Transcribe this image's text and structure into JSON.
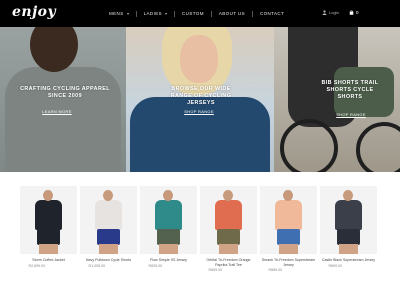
{
  "header": {
    "logo": "enjoy",
    "nav": [
      {
        "label": "MENS",
        "dropdown": true
      },
      {
        "label": "LADIES",
        "dropdown": true
      },
      {
        "label": "CUSTOM",
        "dropdown": false
      },
      {
        "label": "ABOUT US",
        "dropdown": false
      },
      {
        "label": "CONTACT",
        "dropdown": false
      }
    ],
    "account_label": "Login",
    "cart_count": "0"
  },
  "hero": {
    "panels": [
      {
        "title": "CRAFTING CYCLING APPAREL SINCE 2009",
        "link": "LEARN MORE"
      },
      {
        "title": "BROWSE OUR WIDE RANGE OF CYCLING JERSEYS",
        "link": "SHOP RANGE"
      },
      {
        "title": "BIB SHORTS TRAIL SHORTS CYCLE SHORTS",
        "link": "SHOP RANGE"
      }
    ]
  },
  "products": [
    {
      "name": "Storm Cuffed Jacket",
      "price": "R2,699.00",
      "top_color": "#1f232b",
      "bottom_color": "#1f232b"
    },
    {
      "name": "Navy Pulldown Cycle Shorts",
      "price": "R1,095.00",
      "top_color": "#e6e3e0",
      "bottom_color": "#2a3a8a"
    },
    {
      "name": "Flow Simple SS Jersey",
      "price": "R839.00",
      "top_color": "#2f8a8a",
      "bottom_color": "#53614f"
    },
    {
      "name": "Orbital Tri-Freedom Orange Paprika Trail Tee",
      "price": "R659.00",
      "top_color": "#e06d4f",
      "bottom_color": "#6f6a4a"
    },
    {
      "name": "Smash Tri-Freedom Superstream Jersey",
      "price": "R889.00",
      "top_color": "#f0b99a",
      "bottom_color": "#3f6fb0"
    },
    {
      "name": "Castle Black Superstream Jersey",
      "price": "R899.00",
      "top_color": "#3a3f4a",
      "bottom_color": "#2a2e38"
    }
  ],
  "colors": {
    "header_bg": "#000000",
    "page_bg": "#ffffff"
  }
}
